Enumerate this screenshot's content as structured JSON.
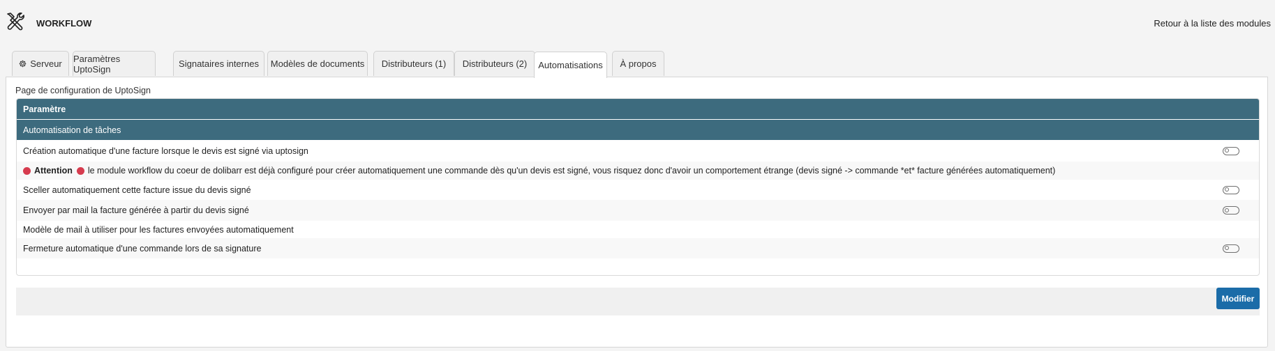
{
  "header": {
    "icon": "tools-icon",
    "title": "WORKFLOW",
    "back_link": "Retour à la liste des modules"
  },
  "tabs": [
    {
      "label": "Serveur",
      "icon": "gear-icon"
    },
    {
      "label": "Paramètres UptoSign"
    },
    {
      "label": "Signataires internes"
    },
    {
      "label": "Modèles de documents"
    },
    {
      "label": "Distributeurs (1)"
    },
    {
      "label": "Distributeurs (2)"
    },
    {
      "label": "Automatisations",
      "active": true
    },
    {
      "label": "À propos"
    }
  ],
  "panel": {
    "caption": "Page de configuration de UptoSign",
    "table_header": "Paramètre",
    "section_header": "Automatisation de tâches",
    "rows": [
      {
        "label": "Création automatique d'une facture lorsque le devis est signé via uptosign",
        "toggle": "off"
      },
      {
        "warning_title": "Attention",
        "warning_text": "le module workflow du coeur de dolibarr est déjà configuré pour créer automatiquement une commande dès qu'un devis est signé, vous risquez donc d'avoir un comportement étrange (devis signé -> commande *et* facture générées automatiquement)"
      },
      {
        "label": "Sceller automatiquement cette facture issue du devis signé",
        "toggle": "off"
      },
      {
        "label": "Envoyer par mail la facture générée à partir du devis signé",
        "toggle": "off"
      },
      {
        "label": "Modèle de mail à utiliser pour les factures envoyées automatiquement"
      },
      {
        "label": "Fermeture automatique d'une commande lors de sa signature",
        "toggle": "off"
      }
    ]
  },
  "footer": {
    "submit_label": "Modifier"
  },
  "colors": {
    "table_header_bg": "#3d6b7e",
    "button_bg": "#1b6ca8",
    "warning_dot": "#d63b4e"
  }
}
